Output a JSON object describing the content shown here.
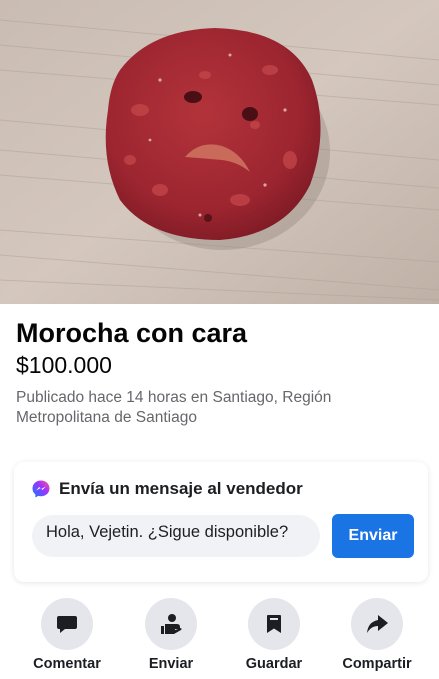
{
  "listing": {
    "title": "Morocha con cara",
    "price": "$100.000",
    "meta": "Publicado hace 14 horas en Santiago, Región Metropolitana de Santiago"
  },
  "message_box": {
    "heading": "Envía un mensaje al vendedor",
    "input_value": "Hola, Vejetin. ¿Sigue disponible?",
    "send_label": "Enviar"
  },
  "actions": [
    {
      "label": "Comentar",
      "icon": "comment-icon"
    },
    {
      "label": "Enviar",
      "icon": "send-user-icon"
    },
    {
      "label": "Guardar",
      "icon": "bookmark-icon"
    },
    {
      "label": "Compartir",
      "icon": "share-icon"
    }
  ],
  "colors": {
    "accent": "#1b74e4",
    "icon_background": "#e4e6eb",
    "secondary_text": "#65676b"
  }
}
